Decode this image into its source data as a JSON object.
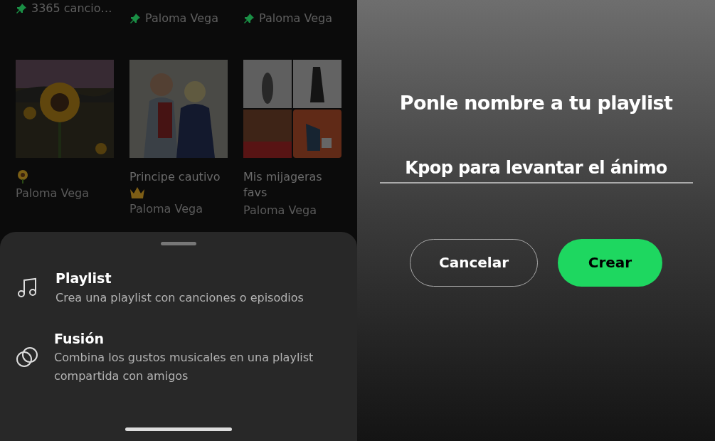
{
  "library": {
    "top_row": [
      {
        "subtitle": "3365 cancio…",
        "pinned": true
      },
      {
        "subtitle": "Paloma Vega",
        "pinned": true
      },
      {
        "subtitle": "Paloma Vega",
        "pinned": true
      }
    ],
    "playlists": [
      {
        "kind": "sunflower",
        "owner": "Paloma Vega"
      },
      {
        "kind": "crown",
        "title_lines": [
          "Principe cautivo"
        ],
        "owner": "Paloma Vega"
      },
      {
        "kind": "mosaic",
        "title_lines": [
          "Mis mijageras",
          "favs"
        ],
        "owner": "Paloma Vega"
      }
    ]
  },
  "create_sheet": {
    "options": [
      {
        "kind": "playlist",
        "title": "Playlist",
        "description": "Crea una playlist con canciones o episodios"
      },
      {
        "kind": "blend",
        "title": "Fusión",
        "description": "Combina los gustos musicales en una playlist compartida con amigos"
      }
    ]
  },
  "name_dialog": {
    "title": "Ponle nombre a tu playlist",
    "value": "Kpop para levantar el ánimo",
    "buttons": [
      {
        "label": "Cancelar",
        "kind": "secondary"
      },
      {
        "label": "Crear",
        "kind": "primary"
      }
    ]
  }
}
